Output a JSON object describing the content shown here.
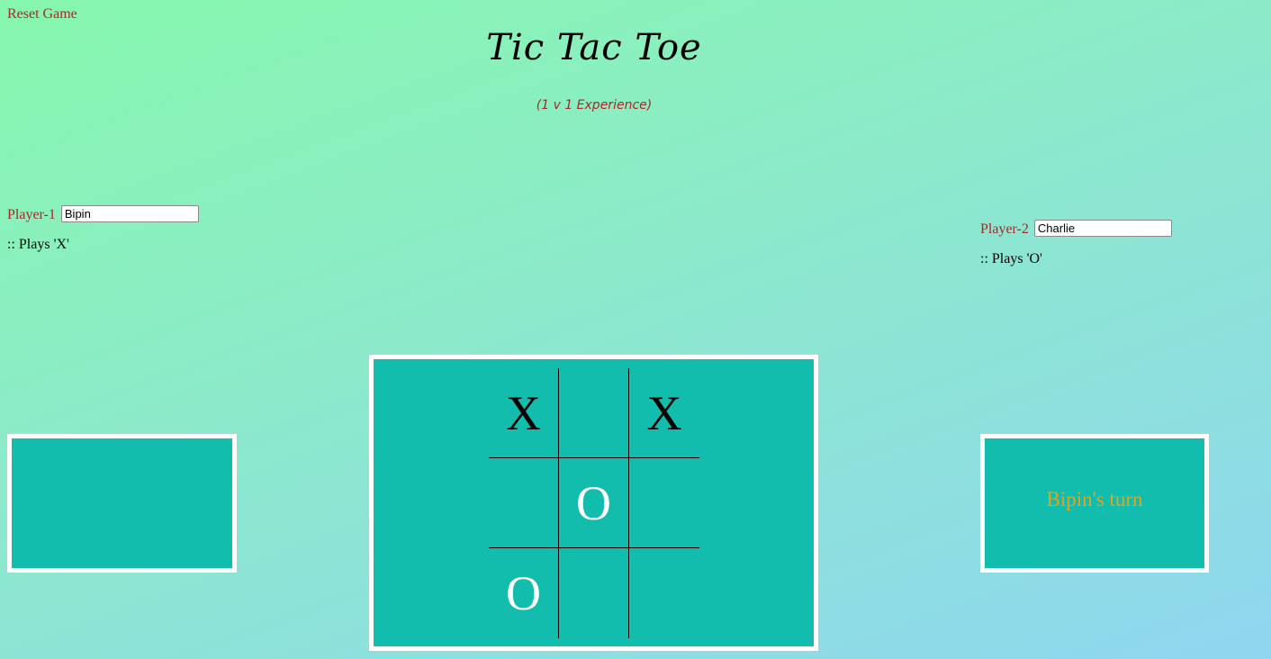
{
  "header": {
    "reset_label": "Reset Game",
    "title": "Tic Tac Toe",
    "subtitle": "(1 v 1 Experience)"
  },
  "players": [
    {
      "label": "Player-1",
      "name": "Bipin",
      "plays": ":: Plays 'X'"
    },
    {
      "label": "Player-2",
      "name": "Charlie",
      "plays": ":: Plays 'O'"
    }
  ],
  "status": {
    "left_panel_text": "",
    "turn_text": "Bipin's turn"
  },
  "board": {
    "cells": [
      "X",
      "",
      "X",
      "",
      "O",
      "",
      "O",
      "",
      ""
    ]
  },
  "colors": {
    "accent_text": "#a52a2a",
    "panel_bg": "#12bdad",
    "turn_text": "#e0a51f",
    "x_mark": "#000000",
    "o_mark": "#ffffff"
  }
}
